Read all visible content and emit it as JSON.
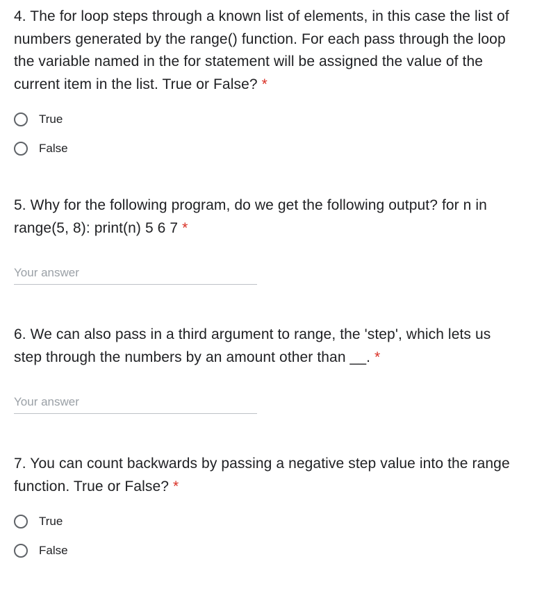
{
  "questions": {
    "q4": {
      "text": "4. The for loop steps through a known list of elements, in this case the list of numbers generated by the range() function. For each pass through the loop the variable named in the for statement will be assigned the value of the current item in the list. True or False? ",
      "star": "*",
      "options": {
        "true": "True",
        "false": "False"
      }
    },
    "q5": {
      "text": "5. Why for the following program, do we get the following output? for n in range(5, 8): print(n) 5 6 7 ",
      "star": "*",
      "placeholder": "Your answer"
    },
    "q6": {
      "text": "6. We can also pass in a third argument to range, the 'step', which lets us step through the numbers by an amount other than __. ",
      "star": "*",
      "placeholder": "Your answer"
    },
    "q7": {
      "text": "7. You can count backwards by passing a negative step value into the range function. True or False? ",
      "star": "*",
      "options": {
        "true": "True",
        "false": "False"
      }
    }
  }
}
